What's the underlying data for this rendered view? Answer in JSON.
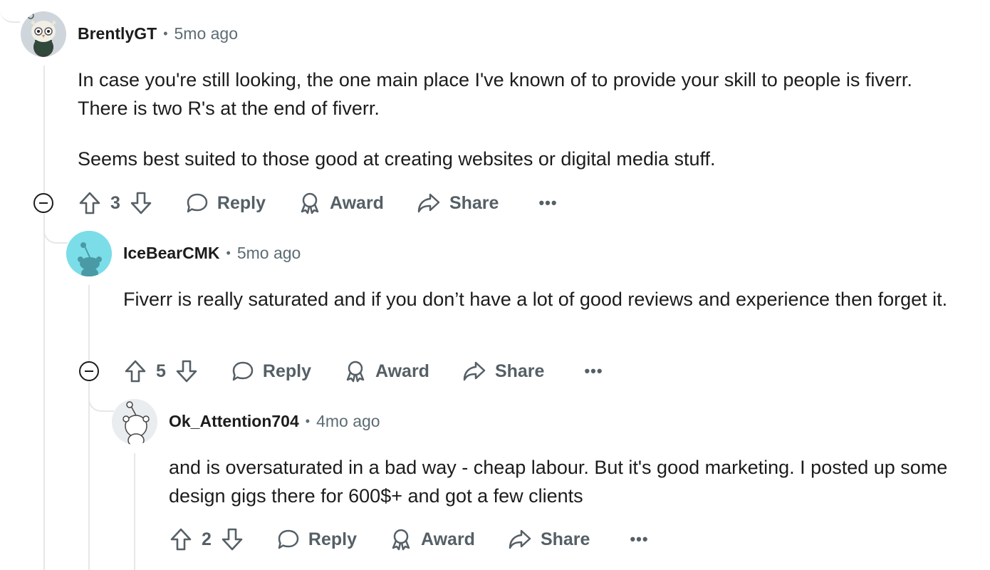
{
  "comments": [
    {
      "author": "BrentlyGT",
      "separator": "•",
      "time": "5mo ago",
      "paragraphs": [
        "In case you're still looking, the one main place I've known of to provide your skill to people is fiverr. There is two R's at the end of fiverr.",
        "Seems best suited to those good at creating websites or digital media stuff."
      ],
      "score": "3",
      "reply_label": "Reply",
      "award_label": "Award",
      "share_label": "Share",
      "more_label": "•••"
    },
    {
      "author": "IceBearCMK",
      "separator": "•",
      "time": "5mo ago",
      "paragraphs": [
        "Fiverr is really saturated and if you don’t have a lot of good reviews and experience then forget it."
      ],
      "score": "5",
      "reply_label": "Reply",
      "award_label": "Award",
      "share_label": "Share",
      "more_label": "•••"
    },
    {
      "author": "Ok_Attention704",
      "separator": "•",
      "time": "4mo ago",
      "paragraphs": [
        "and is oversaturated in a bad way - cheap labour. But it's good marketing. I posted up some design gigs there for 600$+ and got a few clients"
      ],
      "score": "2",
      "reply_label": "Reply",
      "award_label": "Award",
      "share_label": "Share",
      "more_label": "•••"
    }
  ],
  "colors": {
    "text": "#1c1c1c",
    "muted": "#5c6c74",
    "thread_line": "#e5e7e9",
    "icebear_avatar_bg": "#7bdde8"
  }
}
